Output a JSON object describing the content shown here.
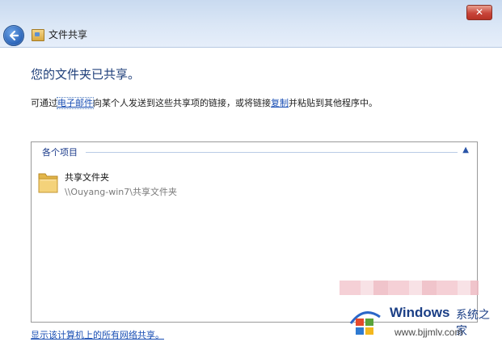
{
  "window": {
    "close_glyph": "✕",
    "title": "文件共享"
  },
  "main": {
    "headline": "您的文件夹已共享。",
    "description": {
      "part1": "可通过",
      "email_link": "电子邮件",
      "part2": "向某个人发送到这些共享项的链接，或将链接",
      "copy_link": "复制",
      "part3": "并粘贴到其他程序中。"
    }
  },
  "items_panel": {
    "group_label": "各个项目",
    "collapse_icon": "chevron-up-icon",
    "items": [
      {
        "name": "共享文件夹",
        "path": "\\\\Ouyang-win7\\共享文件夹",
        "icon": "folder-icon"
      }
    ]
  },
  "footer": {
    "show_all_link": "显示该计算机上的所有网络共享。"
  },
  "watermark": {
    "brand": "Windows",
    "cn": "系统之家",
    "url": "www.bjjmlv.com"
  },
  "colors": {
    "accent": "#1a4fb4",
    "headline": "#1f3f7a",
    "titlebar": "#dbe7f6"
  }
}
